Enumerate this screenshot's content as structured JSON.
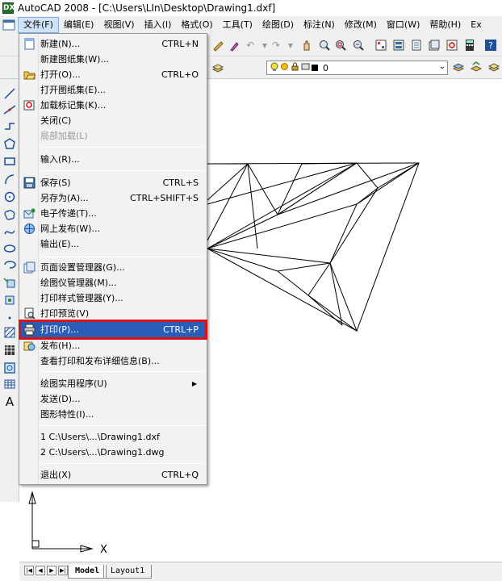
{
  "window": {
    "title": "AutoCAD 2008 - [C:\\Users\\LIn\\Desktop\\Drawing1.dxf]",
    "app_icon": "DX"
  },
  "menubar": {
    "items": [
      "文件(F)",
      "编辑(E)",
      "视图(V)",
      "插入(I)",
      "格式(O)",
      "工具(T)",
      "绘图(D)",
      "标注(N)",
      "修改(M)",
      "窗口(W)",
      "帮助(H)",
      "Ex"
    ]
  },
  "layer": {
    "current": "0"
  },
  "file_menu": {
    "items": [
      {
        "label": "新建(N)...",
        "shortcut": "CTRL+N",
        "icon": "new-document-icon"
      },
      {
        "label": "新建图纸集(W)...",
        "shortcut": ""
      },
      {
        "label": "打开(O)...",
        "shortcut": "CTRL+O",
        "icon": "open-folder-icon"
      },
      {
        "label": "打开图纸集(E)...",
        "shortcut": ""
      },
      {
        "label": "加载标记集(K)...",
        "shortcut": "",
        "icon": "markup-set-icon"
      },
      {
        "label": "关闭(C)",
        "shortcut": ""
      },
      {
        "label": "局部加载(L)",
        "shortcut": "",
        "disabled": true
      },
      {
        "label": "输入(R)...",
        "shortcut": ""
      },
      {
        "label": "保存(S)",
        "shortcut": "CTRL+S",
        "icon": "save-icon"
      },
      {
        "label": "另存为(A)...",
        "shortcut": "CTRL+SHIFT+S"
      },
      {
        "label": "电子传递(T)...",
        "shortcut": "",
        "icon": "etransmit-icon"
      },
      {
        "label": "网上发布(W)...",
        "shortcut": "",
        "icon": "publish-web-icon"
      },
      {
        "label": "输出(E)...",
        "shortcut": ""
      },
      {
        "label": "页面设置管理器(G)...",
        "shortcut": "",
        "icon": "page-setup-icon"
      },
      {
        "label": "绘图仪管理器(M)...",
        "shortcut": ""
      },
      {
        "label": "打印样式管理器(Y)...",
        "shortcut": ""
      },
      {
        "label": "打印预览(V)",
        "shortcut": "",
        "icon": "print-preview-icon"
      },
      {
        "label": "打印(P)...",
        "shortcut": "CTRL+P",
        "icon": "print-icon",
        "highlighted": true
      },
      {
        "label": "发布(H)...",
        "shortcut": "",
        "icon": "publish-icon"
      },
      {
        "label": "查看打印和发布详细信息(B)...",
        "shortcut": ""
      },
      {
        "label": "绘图实用程序(U)",
        "shortcut": "",
        "submenu": true
      },
      {
        "label": "发送(D)...",
        "shortcut": ""
      },
      {
        "label": "图形特性(I)...",
        "shortcut": ""
      },
      {
        "label": "1 C:\\Users\\...\\Drawing1.dxf",
        "shortcut": ""
      },
      {
        "label": "2 C:\\Users\\...\\Drawing1.dwg",
        "shortcut": ""
      },
      {
        "label": "退出(X)",
        "shortcut": "CTRL+Q"
      }
    ]
  },
  "canvas": {
    "ucs_x_label": "X"
  },
  "tabs": {
    "items": [
      "Model",
      "Layout1"
    ]
  },
  "colors": {
    "highlight": "#2a5db8",
    "highlight_outline": "#e01010"
  }
}
